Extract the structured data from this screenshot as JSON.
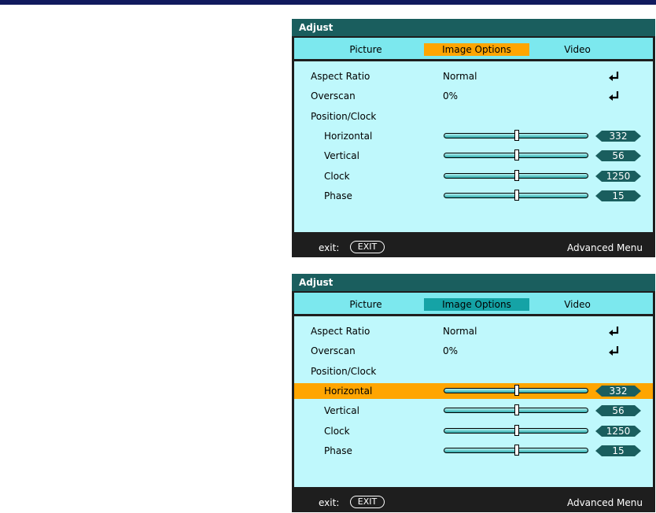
{
  "menus": [
    {
      "title": "Adjust",
      "tabs": [
        "Picture",
        "Image Options",
        "Video"
      ],
      "selected_tab_color": "#ffa500",
      "highlighted_row": "",
      "rows": {
        "aspect_ratio": {
          "label": "Aspect Ratio",
          "value": "Normal"
        },
        "overscan": {
          "label": "Overscan",
          "value": "0%"
        },
        "position_clock": {
          "label": "Position/Clock"
        },
        "horizontal": {
          "label": "Horizontal",
          "value": "332"
        },
        "vertical": {
          "label": "Vertical",
          "value": "56"
        },
        "clock": {
          "label": "Clock",
          "value": "1250"
        },
        "phase": {
          "label": "Phase",
          "value": "15"
        }
      },
      "footer": {
        "exit_label": "exit:",
        "exit_button": "EXIT",
        "advanced": "Advanced Menu"
      }
    },
    {
      "title": "Adjust",
      "tabs": [
        "Picture",
        "Image Options",
        "Video"
      ],
      "selected_tab_color": "#15a3a6",
      "highlighted_row": "horizontal",
      "rows": {
        "aspect_ratio": {
          "label": "Aspect Ratio",
          "value": "Normal"
        },
        "overscan": {
          "label": "Overscan",
          "value": "0%"
        },
        "position_clock": {
          "label": "Position/Clock"
        },
        "horizontal": {
          "label": "Horizontal",
          "value": "332"
        },
        "vertical": {
          "label": "Vertical",
          "value": "56"
        },
        "clock": {
          "label": "Clock",
          "value": "1250"
        },
        "phase": {
          "label": "Phase",
          "value": "15"
        }
      },
      "footer": {
        "exit_label": "exit:",
        "exit_button": "EXIT",
        "advanced": "Advanced Menu"
      }
    }
  ],
  "colors": {
    "title_bar": "#1a5e5e",
    "tab_bar": "#7ce8ee",
    "panel": "#bff8fc",
    "highlight": "#ffa500",
    "badge": "#1a5e5e",
    "frame": "#1e1e1e"
  },
  "icons": {
    "enter": "enter-return-icon",
    "value_badge": "hexagon-badge-icon"
  }
}
